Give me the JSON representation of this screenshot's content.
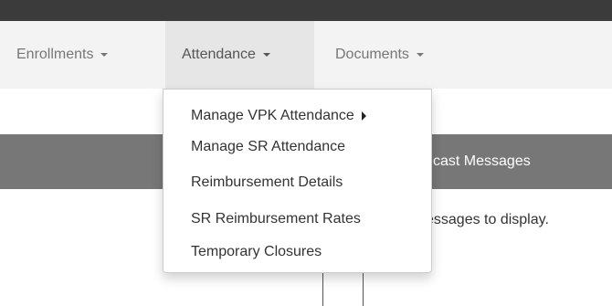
{
  "nav": {
    "items": [
      {
        "label": "Enrollments",
        "active": false
      },
      {
        "label": "Attendance",
        "active": true
      },
      {
        "label": "Documents",
        "active": false
      }
    ]
  },
  "dropdown": {
    "items": [
      {
        "label": "Manage VPK Attendance",
        "has_submenu": true
      },
      {
        "label": "Manage SR Attendance",
        "has_submenu": false
      },
      {
        "label": "Reimbursement Details",
        "has_submenu": false
      },
      {
        "label": "SR Reimbursement Rates",
        "has_submenu": false
      },
      {
        "label": "Temporary Closures",
        "has_submenu": false
      }
    ]
  },
  "panel": {
    "title_visible": "cast Messages",
    "body_visible": "essages to display."
  },
  "icons": {
    "nav_caret": "caret-down-icon",
    "submenu": "caret-right-icon"
  },
  "colors": {
    "top_bar": "#3b3b3b",
    "nav_bg": "#f3f3f3",
    "nav_active_bg": "#e6e6e6",
    "panel_header_bg": "#777777"
  }
}
